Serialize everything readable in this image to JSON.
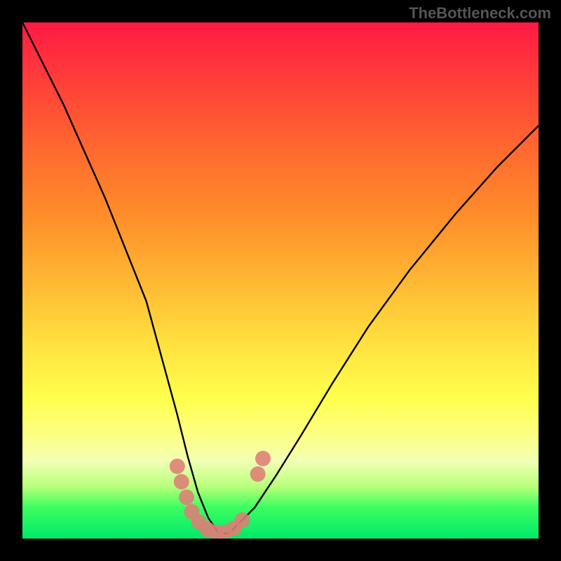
{
  "watermark": "TheBottleneck.com",
  "chart_data": {
    "type": "line",
    "title": "",
    "xlabel": "",
    "ylabel": "",
    "xlim": [
      0,
      100
    ],
    "ylim": [
      0,
      100
    ],
    "grid": false,
    "series": [
      {
        "name": "left-curve",
        "x": [
          0,
          4,
          8,
          12,
          16,
          20,
          24,
          27,
          30,
          32,
          34,
          36,
          38
        ],
        "values": [
          100,
          92,
          84,
          75,
          66,
          56,
          46,
          35,
          24,
          16,
          9,
          4,
          1
        ]
      },
      {
        "name": "right-curve",
        "x": [
          38,
          40,
          42,
          45,
          49,
          54,
          60,
          67,
          75,
          84,
          92,
          100
        ],
        "values": [
          1,
          1,
          3,
          6,
          12,
          20,
          30,
          41,
          52,
          63,
          72,
          80
        ]
      },
      {
        "name": "floor",
        "x": [
          30,
          34,
          36,
          38,
          40,
          42,
          45
        ],
        "values": [
          1,
          1,
          1,
          1,
          1,
          1,
          1
        ]
      }
    ],
    "markers": {
      "name": "highlight-points",
      "color": "#de7d76",
      "points": [
        {
          "x": 30.0,
          "y": 14.0
        },
        {
          "x": 30.8,
          "y": 11.0
        },
        {
          "x": 31.8,
          "y": 8.0
        },
        {
          "x": 32.8,
          "y": 5.2
        },
        {
          "x": 34.2,
          "y": 3.2
        },
        {
          "x": 35.8,
          "y": 1.8
        },
        {
          "x": 37.5,
          "y": 1.2
        },
        {
          "x": 39.2,
          "y": 1.2
        },
        {
          "x": 41.0,
          "y": 2.0
        },
        {
          "x": 42.6,
          "y": 3.6
        },
        {
          "x": 45.6,
          "y": 12.5
        },
        {
          "x": 46.6,
          "y": 15.5
        }
      ]
    },
    "background_gradient": {
      "top": "#ff1a44",
      "bottom": "#00e86a"
    }
  }
}
